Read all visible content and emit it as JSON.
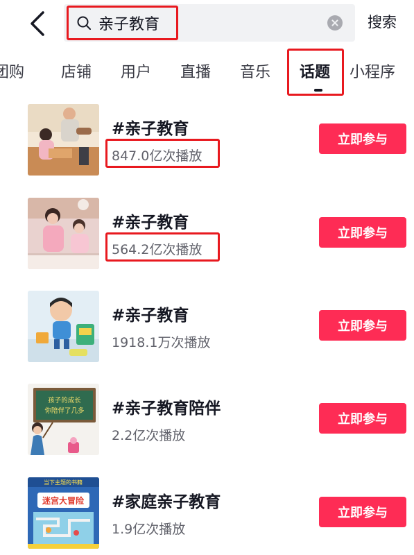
{
  "search": {
    "query": "亲子教育",
    "submit_label": "搜索"
  },
  "tabs": [
    {
      "label": "团购",
      "active": false
    },
    {
      "label": "店铺",
      "active": false
    },
    {
      "label": "用户",
      "active": false
    },
    {
      "label": "直播",
      "active": false
    },
    {
      "label": "音乐",
      "active": false
    },
    {
      "label": "话题",
      "active": true
    },
    {
      "label": "小程序",
      "active": false
    }
  ],
  "results": [
    {
      "title": "#亲子教育",
      "plays": "847.0亿次播放",
      "button": "立即参与",
      "highlighted": true
    },
    {
      "title": "#亲子教育",
      "plays": "564.2亿次播放",
      "button": "立即参与",
      "highlighted": true
    },
    {
      "title": "#亲子教育",
      "plays": "1918.1万次播放",
      "button": "立即参与",
      "highlighted": false
    },
    {
      "title": "#亲子教育陪伴",
      "plays": "2.2亿次播放",
      "button": "立即参与",
      "highlighted": false
    },
    {
      "title": "#家庭亲子教育",
      "plays": "1.9亿次播放",
      "button": "立即参与",
      "highlighted": false
    }
  ],
  "thumb4_text": [
    "孩子的成长",
    "你陪伴了几多"
  ],
  "thumb5_text": [
    "当下主题的书籍",
    "迷宫大冒险"
  ],
  "colors": {
    "accent": "#fe2c55",
    "highlight_box": "#e8191f",
    "search_bg": "#f1f2f4",
    "secondary_text": "#61626b"
  }
}
